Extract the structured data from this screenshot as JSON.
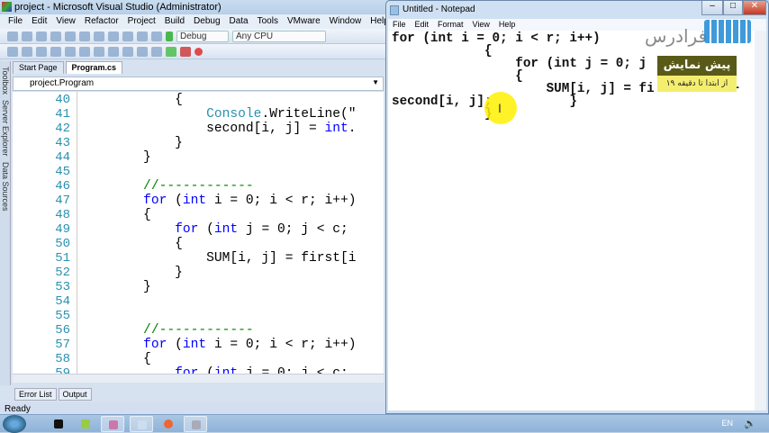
{
  "vs": {
    "title": "project - Microsoft Visual Studio (Administrator)",
    "menu": [
      "File",
      "Edit",
      "View",
      "Refactor",
      "Project",
      "Build",
      "Debug",
      "Data",
      "Tools",
      "VMware",
      "Window",
      "Help"
    ],
    "config": "Debug",
    "platform": "Any CPU",
    "side_tabs": [
      "Toolbox",
      "Server Explorer",
      "Data Sources"
    ],
    "tabs": [
      "Start Page",
      "Program.cs"
    ],
    "nav": "project.Program",
    "lines": [
      {
        "n": "40",
        "code": "            {"
      },
      {
        "n": "41",
        "code": "                Console.WriteLine(\""
      },
      {
        "n": "42",
        "code": "                second[i, j] = int."
      },
      {
        "n": "43",
        "code": "            }"
      },
      {
        "n": "44",
        "code": "        }"
      },
      {
        "n": "45",
        "code": ""
      },
      {
        "n": "46",
        "code": "        //------------"
      },
      {
        "n": "47",
        "code": "        for (int i = 0; i < r; i++)"
      },
      {
        "n": "48",
        "code": "        {"
      },
      {
        "n": "49",
        "code": "            for (int j = 0; j < c;"
      },
      {
        "n": "50",
        "code": "            {"
      },
      {
        "n": "51",
        "code": "                SUM[i, j] = first[i"
      },
      {
        "n": "52",
        "code": "            }"
      },
      {
        "n": "53",
        "code": "        }"
      },
      {
        "n": "54",
        "code": ""
      },
      {
        "n": "55",
        "code": ""
      },
      {
        "n": "56",
        "code": "        //------------"
      },
      {
        "n": "57",
        "code": "        for (int i = 0; i < r; i++)"
      },
      {
        "n": "58",
        "code": "        {"
      },
      {
        "n": "59",
        "code": "            for (int j = 0; j < c;"
      }
    ],
    "bottom_tabs": [
      "Error List",
      "Output"
    ],
    "status": "Ready"
  },
  "notepad": {
    "title": "Untitled - Notepad",
    "menu": [
      "File",
      "Edit",
      "Format",
      "View",
      "Help"
    ],
    "lines": [
      "for (int i = 0; i < r; i++)",
      "            {",
      "                for (int j = 0; j",
      "                {",
      "                    SUM[i, j] = fi          +",
      "second[i, j];          }",
      "            }"
    ]
  },
  "watermark": {
    "logo": "فرادرس",
    "badge_title": "پیش نمایش",
    "badge_sub": "از ابتدا تا دقیقه ۱۹"
  },
  "taskbar": {
    "lang": "EN",
    "apps": [
      "cmd",
      "notepad-plus",
      "visual-studio",
      "notepad",
      "firefox",
      "tool"
    ]
  }
}
